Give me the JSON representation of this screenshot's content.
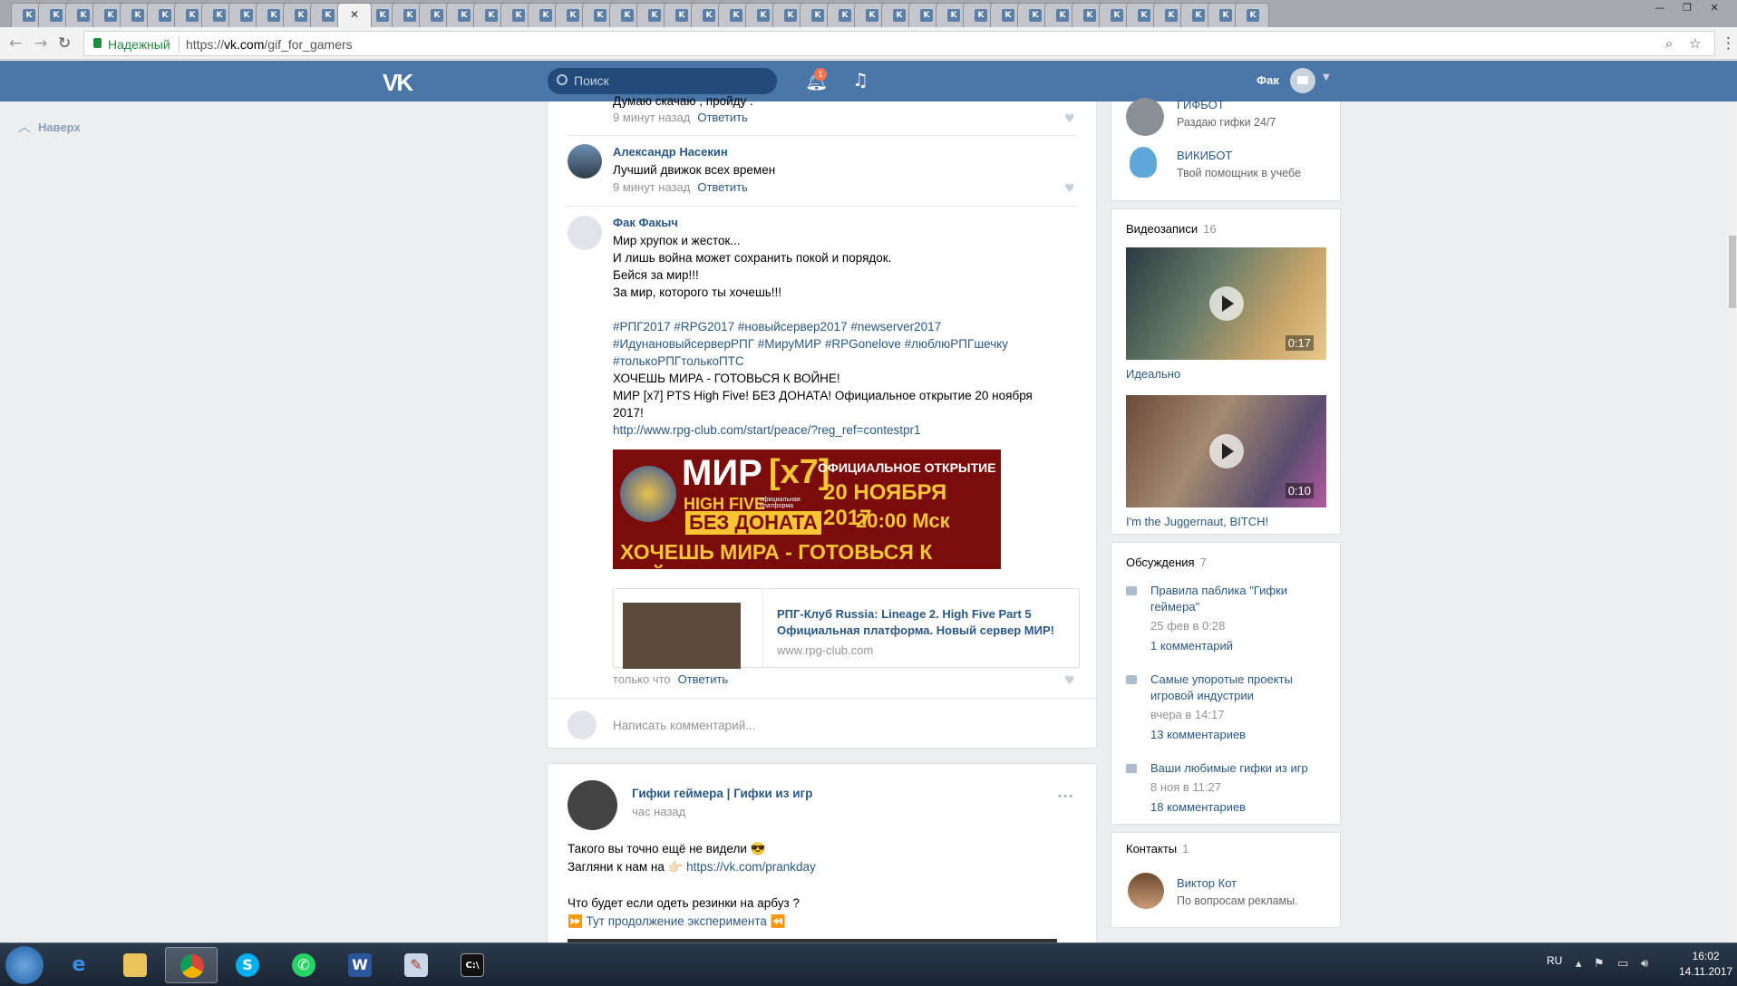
{
  "browser": {
    "tab_count": 46,
    "active_tab_index": 12,
    "address": {
      "secure_label": "Надежный",
      "url_prefix": "https://",
      "url_host": "vk.com",
      "url_path": "/gif_for_gamers"
    }
  },
  "vk_header": {
    "logo": "VK",
    "search_placeholder": "Поиск",
    "notifications_badge": "1",
    "user_name": "Фак"
  },
  "back_to_top": "Наверх",
  "comments": [
    {
      "text": "Думаю скачаю , пройду .",
      "time": "9 минут назад",
      "reply": "Ответить"
    },
    {
      "author": "Александр Насекин",
      "text": "Лучший движок всех времен",
      "time": "9 минут назад",
      "reply": "Ответить"
    },
    {
      "author": "Фак Факыч",
      "lines": [
        "Мир хрупок и жесток...",
        "И лишь война может сохранить покой и порядок.",
        "Бейся за мир!!!",
        "За мир, которого ты хочешь!!!"
      ],
      "tags_line1": "#РПГ2017 #RPG2017 #новыйсервер2017 #newserver2017",
      "tags_line2": "#ИдунановыйсерверРПГ #МируМИР #RPGonelove #люблюРПГшечку",
      "tags_line3": "#толькоРПГтолькоПТС",
      "line_war": "ХОЧЕШЬ МИРА - ГОТОВЬСЯ К ВОЙНЕ!",
      "line_opening": "МИР [x7] PTS High Five! БЕЗ ДОНАТА! Официальное открытие 20 ноября 2017!",
      "link": "http://www.rpg-club.com/start/peace/?reg_ref=contestpr1",
      "banner": {
        "mir": "МИР",
        "x7": "[x7]",
        "high_five": "HIGH FIVE",
        "platform": "официальная платформа",
        "official": "ОФИЦИАЛЬНОЕ ОТКРЫТИЕ",
        "date": "20 НОЯБРЯ 2017",
        "time": "20:00 Мск",
        "no_donate": "БЕЗ ДОНАТА",
        "slogan": "ХОЧЕШЬ МИРА - ГОТОВЬСЯ К ВОЙНЕ"
      },
      "link_card": {
        "title": "РПГ-Клуб Russia: Lineage 2. High Five Part 5 Официальная платформа. Новый сервер МИР!",
        "url": "www.rpg-club.com"
      },
      "time": "только что",
      "reply": "Ответить"
    }
  ],
  "write_comment_placeholder": "Написать комментарий...",
  "post2": {
    "author": "Гифки геймера | Гифки из игр",
    "time": "час назад",
    "line1": "Такого вы точно ещё не видели 😎",
    "line2_prefix": "Загляни к нам на 👉🏻",
    "line2_link": "https://vk.com/prankday",
    "line3": "Что будет если одеть резинки на арбуз ?",
    "line4": "⏩ Тут продолжение эксперимента ⏪"
  },
  "sidebar": {
    "apps": [
      {
        "name": "ГИФБОТ",
        "sub": "Раздаю гифки 24/7"
      },
      {
        "name": "ВИКИБОТ",
        "sub": "Твой помощник в учебе"
      }
    ],
    "videos": {
      "title": "Видеозаписи",
      "count": "16",
      "items": [
        {
          "duration": "0:17",
          "title": "Идеально"
        },
        {
          "duration": "0:10",
          "title": "I'm the Juggernaut, BITCH!"
        }
      ]
    },
    "discussions": {
      "title": "Обсуждения",
      "count": "7",
      "items": [
        {
          "title": "Правила паблика \"Гифки геймера\"",
          "date": "25 фев в 0:28",
          "comments": "1 комментарий"
        },
        {
          "title": "Самые упоротые проекты игровой индустрии",
          "date": "вчера в 14:17",
          "comments": "13 комментариев"
        },
        {
          "title": "Ваши любимые гифки из игр",
          "date": "8 ноя в 11:27",
          "comments": "18 комментариев"
        }
      ]
    },
    "contacts": {
      "title": "Контакты",
      "count": "1",
      "items": [
        {
          "name": "Виктор Кот",
          "role": "По вопросам рекламы."
        }
      ]
    }
  },
  "taskbar": {
    "lang": "RU",
    "time": "16:02",
    "date": "14.11.2017"
  }
}
